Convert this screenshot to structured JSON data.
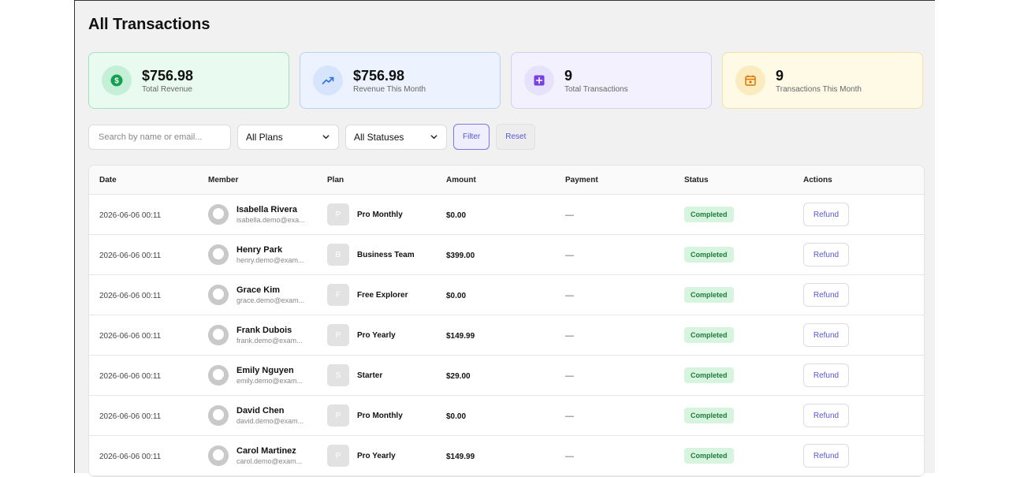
{
  "page": {
    "title": "All Transactions"
  },
  "stats": [
    {
      "value": "$756.98",
      "label": "Total Revenue",
      "icon": "dollar-icon",
      "bg": "#e9faf0",
      "border": "#9fe3bd",
      "iconBg": "#c6efd8",
      "iconColor": "#12a150"
    },
    {
      "value": "$756.98",
      "label": "Revenue This Month",
      "icon": "trending-up-icon",
      "bg": "#ecf3fe",
      "border": "#b9d1f5",
      "iconBg": "#d6e5fc",
      "iconColor": "#2f6fe0"
    },
    {
      "value": "9",
      "label": "Total Transactions",
      "icon": "plus-square-icon",
      "bg": "#f3f1fd",
      "border": "#d4cdf4",
      "iconBg": "#e7e2fb",
      "iconColor": "#7a3fe0"
    },
    {
      "value": "9",
      "label": "Transactions This Month",
      "icon": "calendar-icon",
      "bg": "#fefae6",
      "border": "#f2e2a4",
      "iconBg": "#fbecc0",
      "iconColor": "#d97706"
    }
  ],
  "filters": {
    "search_placeholder": "Search by name or email...",
    "plan_select": "All Plans",
    "status_select": "All Statuses",
    "filter_label": "Filter",
    "reset_label": "Reset"
  },
  "table": {
    "columns": [
      "Date",
      "Member",
      "Plan",
      "Amount",
      "Payment",
      "Status",
      "Actions"
    ],
    "rows": [
      {
        "date": "2026-06-06 00:11",
        "name": "Isabella Rivera",
        "email": "isabella.demo@exa...",
        "plan_initial": "P",
        "plan": "Pro Monthly",
        "amount": "$0.00",
        "payment": "—",
        "status": "Completed",
        "action": "Refund"
      },
      {
        "date": "2026-06-06 00:11",
        "name": "Henry Park",
        "email": "henry.demo@exam...",
        "plan_initial": "B",
        "plan": "Business Team",
        "amount": "$399.00",
        "payment": "—",
        "status": "Completed",
        "action": "Refund"
      },
      {
        "date": "2026-06-06 00:11",
        "name": "Grace Kim",
        "email": "grace.demo@exam...",
        "plan_initial": "F",
        "plan": "Free Explorer",
        "amount": "$0.00",
        "payment": "—",
        "status": "Completed",
        "action": "Refund"
      },
      {
        "date": "2026-06-06 00:11",
        "name": "Frank Dubois",
        "email": "frank.demo@exam...",
        "plan_initial": "P",
        "plan": "Pro Yearly",
        "amount": "$149.99",
        "payment": "—",
        "status": "Completed",
        "action": "Refund"
      },
      {
        "date": "2026-06-06 00:11",
        "name": "Emily Nguyen",
        "email": "emily.demo@exam...",
        "plan_initial": "S",
        "plan": "Starter",
        "amount": "$29.00",
        "payment": "—",
        "status": "Completed",
        "action": "Refund"
      },
      {
        "date": "2026-06-06 00:11",
        "name": "David Chen",
        "email": "david.demo@exam...",
        "plan_initial": "P",
        "plan": "Pro Monthly",
        "amount": "$0.00",
        "payment": "—",
        "status": "Completed",
        "action": "Refund"
      },
      {
        "date": "2026-06-06 00:11",
        "name": "Carol Martinez",
        "email": "carol.demo@exam...",
        "plan_initial": "P",
        "plan": "Pro Yearly",
        "amount": "$149.99",
        "payment": "—",
        "status": "Completed",
        "action": "Refund"
      }
    ]
  }
}
